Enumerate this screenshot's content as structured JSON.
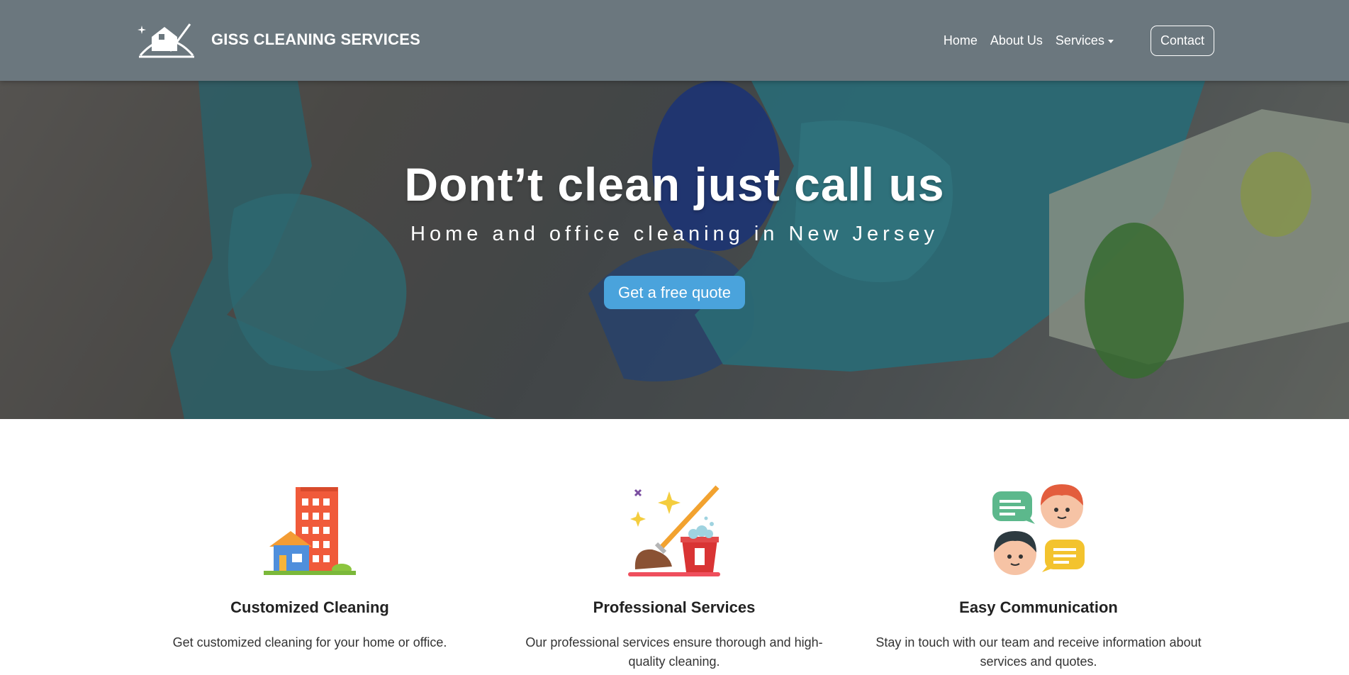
{
  "brand": {
    "name": "GISS CLEANING SERVICES"
  },
  "nav": {
    "home": "Home",
    "about": "About Us",
    "services": "Services",
    "contact": "Contact"
  },
  "hero": {
    "title": "Dont’t clean just call us",
    "subtitle": "Home and office cleaning in New Jersey",
    "cta": "Get a free quote"
  },
  "features": [
    {
      "icon": "building-house-icon",
      "title": "Customized Cleaning",
      "text": "Get customized cleaning for your home or office."
    },
    {
      "icon": "mop-bucket-icon",
      "title": "Professional Services",
      "text": "Our professional services ensure thorough and high-quality cleaning."
    },
    {
      "icon": "people-chat-icon",
      "title": "Easy Communication",
      "text": "Stay in touch with our team and receive information about services and quotes."
    }
  ],
  "colors": {
    "navbar": "#6b777e",
    "cta": "#4aa3dc"
  }
}
